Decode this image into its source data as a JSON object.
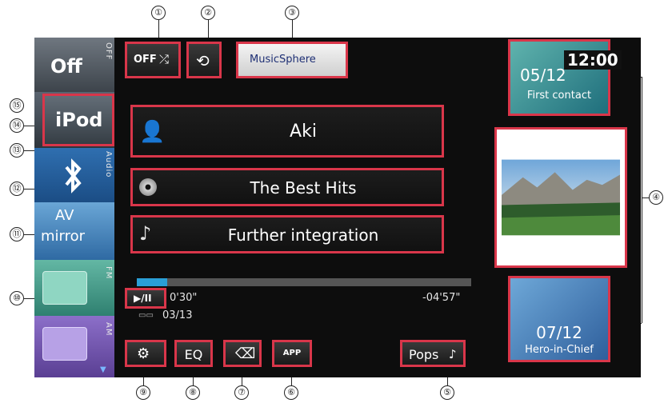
{
  "callouts": [
    "①",
    "②",
    "③",
    "④",
    "⑤",
    "⑥",
    "⑦",
    "⑧",
    "⑨",
    "⑩",
    "⑪",
    "⑫",
    "⑬",
    "⑭",
    "⑮"
  ],
  "sources": {
    "off": "Off",
    "off_vertical": "OFF",
    "ipod": "iPod",
    "audio_vertical": "Audio",
    "av_line1": "AV",
    "av_line2": "mirror",
    "fm_vertical": "FM",
    "am_vertical": "AM"
  },
  "top": {
    "shuffle_label": "OFF",
    "musicsphere": "MusicSphere"
  },
  "track": {
    "artist": "Aki",
    "album": "The Best Hits",
    "song": "Further integration",
    "elapsed": "0'30\"",
    "remaining": "-04'57\"",
    "track_number": "03/13",
    "progress": 0.09
  },
  "clock": "12:00",
  "side_panels": {
    "upper_date": "05/12",
    "upper_title": "First contact",
    "lower_date": "07/12",
    "lower_title": "Hero-in-Chief"
  },
  "bottom": {
    "eq": "EQ",
    "app": "APP",
    "pops": "Pops"
  },
  "colors": {
    "highlight": "#d9364a",
    "screen_bg": "#0d0d0d",
    "progress": "#2a9fd6"
  }
}
